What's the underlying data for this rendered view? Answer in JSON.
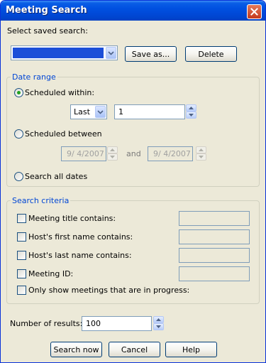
{
  "window": {
    "title": "Meeting Search"
  },
  "saved_search": {
    "label": "Select saved search:",
    "save_as_label": "Save as...",
    "delete_label": "Delete"
  },
  "date_range": {
    "legend": "Date range",
    "scheduled_within_label": "Scheduled within:",
    "within_unit": "Last",
    "within_value": "1",
    "scheduled_between_label": "Scheduled between",
    "between_from": "9/  4/2007",
    "and_label": "and",
    "between_to": "9/  4/2007",
    "all_dates_label": "Search all dates",
    "selected": "scheduled_within"
  },
  "criteria": {
    "legend": "Search criteria",
    "title_label": "Meeting title contains:",
    "first_name_label": "Host's first name contains:",
    "last_name_label": "Host's last name contains:",
    "meeting_id_label": "Meeting ID:",
    "in_progress_label": "Only show meetings that are in progress:"
  },
  "results": {
    "label": "Number of results:",
    "value": "100"
  },
  "buttons": {
    "search_now": "Search now",
    "cancel": "Cancel",
    "help": "Help"
  },
  "colors": {
    "titlebar": "#0050e0",
    "dialog_bg": "#ece9d8",
    "selection": "#1c4fd8",
    "legend_text": "#0046d5",
    "radio_dot": "#21a121"
  }
}
